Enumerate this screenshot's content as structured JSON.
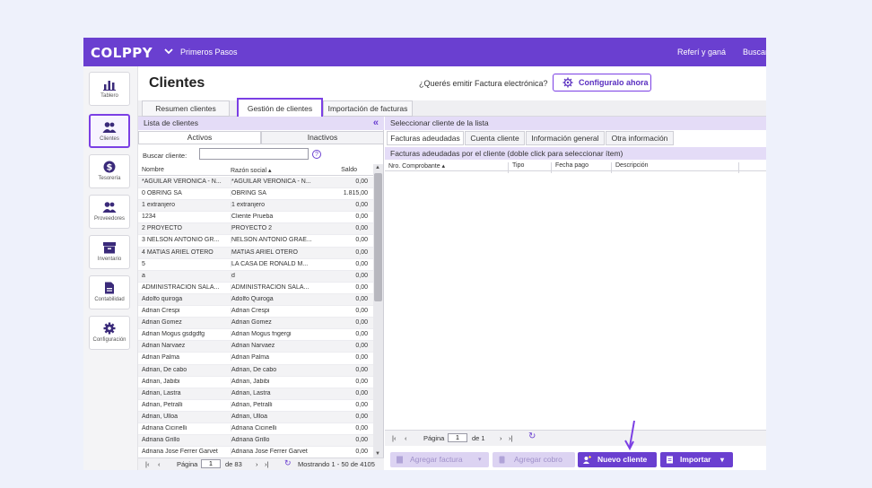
{
  "topbar": {
    "logo": "COLPPY",
    "nav_label": "Primeros Pasos",
    "refer": "Referí y ganá",
    "search": "Buscar"
  },
  "sidebar": {
    "items": [
      {
        "label": "Tablero",
        "icon": "bar-chart-icon"
      },
      {
        "label": "Clientes",
        "icon": "users-icon"
      },
      {
        "label": "Tesorería",
        "icon": "dollar-icon"
      },
      {
        "label": "Proveedores",
        "icon": "users-icon"
      },
      {
        "label": "Inventario",
        "icon": "archive-icon"
      },
      {
        "label": "Contabilidad",
        "icon": "document-icon"
      },
      {
        "label": "Configuración",
        "icon": "gear-icon"
      }
    ]
  },
  "header": {
    "title": "Clientes",
    "question": "¿Querés emitir Factura electrónica?",
    "config_button": "Configuralo ahora"
  },
  "tabs": [
    "Resumen clientes",
    "Gestión de clientes",
    "Importación de facturas"
  ],
  "left": {
    "title": "Lista de clientes",
    "subtabs": [
      "Activos",
      "Inactivos"
    ],
    "search_label": "Buscar cliente:",
    "search_value": "",
    "help": "?",
    "columns": [
      "Nombre",
      "Razón social ▴",
      "Saldo"
    ],
    "rows": [
      [
        "*AGUILAR VERONICA - N...",
        "*AGUILAR VERONICA - N...",
        "0,00"
      ],
      [
        "0 OBRING SA",
        "OBRING SA",
        "1.815,00"
      ],
      [
        "1 extranjero",
        "1 extranjero",
        "0,00"
      ],
      [
        "1234",
        "Cliente Prueba",
        "0,00"
      ],
      [
        "2 PROYECTO",
        "PROYECTO 2",
        "0,00"
      ],
      [
        "3 NELSON ANTONIO GR...",
        "NELSON ANTONIO GRAE...",
        "0,00"
      ],
      [
        "4 MATIAS ARIEL OTERO",
        "MATIAS ARIEL OTERO",
        "0,00"
      ],
      [
        "5",
        "LA CASA DE RONALD M...",
        "0,00"
      ],
      [
        "a",
        "d",
        "0,00"
      ],
      [
        "ADMINISTRACION SALA...",
        "ADMINISTRACION SALA...",
        "0,00"
      ],
      [
        "Adolfo quiroga",
        "Adolfo Quiroga",
        "0,00"
      ],
      [
        "Adrian Crespi",
        "Adrian Crespi",
        "0,00"
      ],
      [
        "Adrian Gomez",
        "Adrian Gomez",
        "0,00"
      ],
      [
        "Adrian Mogus gsdgdfg",
        "Adrian Mogus fngergi",
        "0,00"
      ],
      [
        "Adrian Narvaez",
        "Adrian Narvaez",
        "0,00"
      ],
      [
        "Adrian Palma",
        "Adrian Palma",
        "0,00"
      ],
      [
        "Adrian, De cabo",
        "Adrian, De cabo",
        "0,00"
      ],
      [
        "Adrian, Jabibi",
        "Adrian, Jabibi",
        "0,00"
      ],
      [
        "Adrian, Lastra",
        "Adrian, Lastra",
        "0,00"
      ],
      [
        "Adrian, Petralli",
        "Adrian, Petralli",
        "0,00"
      ],
      [
        "Adrian, Ulloa",
        "Adrian, Ulloa",
        "0,00"
      ],
      [
        "Adriana Cicinelli",
        "Adriana Cicinelli",
        "0,00"
      ],
      [
        "Adriana Grillo",
        "Adriana Grillo",
        "0,00"
      ],
      [
        "Adriana Jose Ferrer Garvet",
        "Adriana Jose Ferrer Garvet",
        "0,00"
      ]
    ],
    "pager": {
      "page_label": "Página",
      "page_value": "1",
      "of": "de 83",
      "showing": "Mostrando 1 - 50 de 4105"
    }
  },
  "right": {
    "title": "Seleccionar cliente de la lista",
    "tabs": [
      "Facturas adeudadas",
      "Cuenta cliente",
      "Información general",
      "Otra información"
    ],
    "subtitle": "Facturas adeudadas por el cliente (doble click para seleccionar ítem)",
    "columns": [
      "Nro. Comprobante ▴",
      "Tipo",
      "Fecha pago",
      "Descripción"
    ],
    "pager": {
      "page_label": "Página",
      "page_value": "1",
      "of": "de 1"
    },
    "buttons": {
      "add_invoice": "Agregar factura",
      "add_payment": "Agregar cobro",
      "new_client": "Nuevo cliente",
      "import": "Importar"
    }
  },
  "colors": {
    "brand": "#6a3fd0",
    "accent_border": "#7b3fe4",
    "panel_header": "#e4dcf7"
  }
}
